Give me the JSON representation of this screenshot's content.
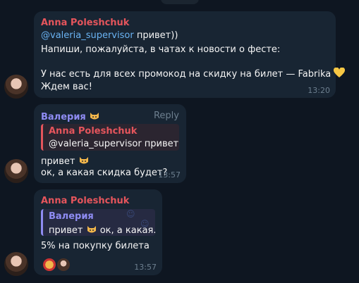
{
  "messages": [
    {
      "author": "Anna Poleshchuk",
      "mention": "@valeria_supervisor",
      "line1_rest": " привет))",
      "line2": "Напиши, пожалуйста, в чатах к новости о фесте:",
      "line3": "У нас есть для всех промокод на скидку на билет — Fabrika",
      "line4": "Ждем вас!",
      "time": "13:20",
      "colors": {
        "author": "#e5555c",
        "mention": "#6ab3f3"
      }
    },
    {
      "author": "Валерия",
      "reply_label": "Reply",
      "quote_author": "Anna Poleshchuk",
      "quote_text": "@valeria_supervisor  привет...",
      "line1": "привет",
      "line2": "ок, а какая скидка будет?",
      "time": "13:57",
      "colors": {
        "author": "#8f8cf3"
      }
    },
    {
      "author": "Anna Poleshchuk",
      "quote_author": "Валерия",
      "quote_text_a": "привет",
      "quote_text_b": " ок, а какая...",
      "line1": "5% на покупку билета",
      "time": "13:57"
    }
  ],
  "colors": {
    "background": "#0e1621",
    "bubble": "#182533",
    "time": "#6d7f8f"
  },
  "icons": [
    "avatar",
    "cat-emoji",
    "yellow-heart-emoji",
    "reaction-avatars"
  ]
}
